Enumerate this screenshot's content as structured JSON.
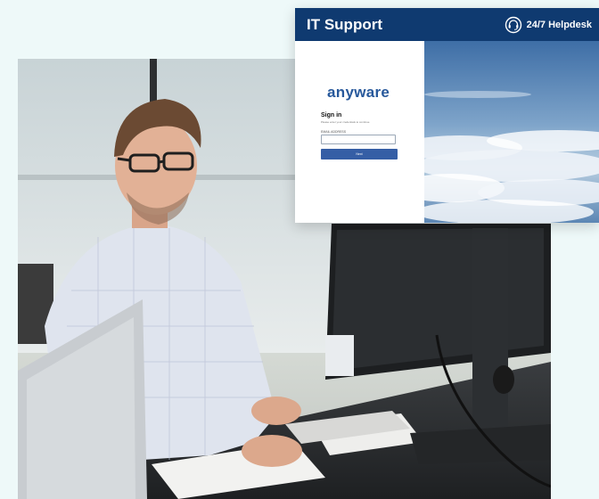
{
  "support_card": {
    "title": "IT Support",
    "helpdesk_label": "24/7 Helpdesk",
    "login": {
      "brand": "anyware",
      "heading": "Sign in",
      "subheading": "Please enter your credentials to continue",
      "email_label": "EMAIL ADDRESS",
      "email_value": "",
      "next_button_label": "Next"
    }
  },
  "colors": {
    "page_background": "#eef9f9",
    "header_background": "#0f3a70",
    "brand": "#27589b",
    "button": "#355ea5"
  },
  "icons": {
    "helpdesk": "headset-icon"
  }
}
